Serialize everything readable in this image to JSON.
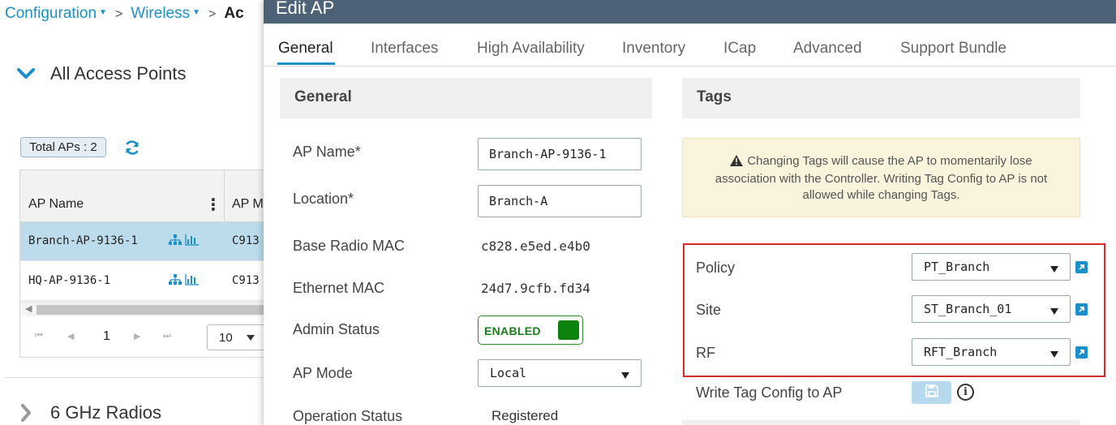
{
  "breadcrumb": {
    "items": [
      "Configuration",
      "Wireless"
    ],
    "separator": ">",
    "current": "Ac"
  },
  "background": {
    "section_all_aps": "All Access Points",
    "total_aps": "Total APs : 2",
    "table": {
      "columns": [
        "AP Name",
        "AP M"
      ],
      "rows": [
        {
          "name": "Branch-AP-9136-1",
          "model": "C913",
          "selected": true
        },
        {
          "name": "HQ-AP-9136-1",
          "model": "C913",
          "selected": false
        }
      ],
      "page": "1",
      "per_page": "10"
    },
    "section_6ghz": "6 GHz Radios"
  },
  "modal": {
    "title": "Edit AP",
    "tabs": [
      {
        "label": "General",
        "active": true
      },
      {
        "label": "Interfaces",
        "active": false
      },
      {
        "label": "High Availability",
        "active": false
      },
      {
        "label": "Inventory",
        "active": false
      },
      {
        "label": "ICap",
        "active": false
      },
      {
        "label": "Advanced",
        "active": false
      },
      {
        "label": "Support Bundle",
        "active": false
      }
    ],
    "general": {
      "heading": "General",
      "ap_name_label": "AP Name*",
      "ap_name_value": "Branch-AP-9136-1",
      "location_label": "Location*",
      "location_value": "Branch-A",
      "base_radio_mac_label": "Base Radio MAC",
      "base_radio_mac_value": "c828.e5ed.e4b0",
      "ethernet_mac_label": "Ethernet MAC",
      "ethernet_mac_value": "24d7.9cfb.fd34",
      "admin_status_label": "Admin Status",
      "admin_status_value": "ENABLED",
      "ap_mode_label": "AP Mode",
      "ap_mode_value": "Local",
      "operation_status_label": "Operation Status",
      "operation_status_value": "Registered"
    },
    "tags": {
      "heading": "Tags",
      "warning": "Changing Tags will cause the AP to momentarily lose association with the Controller. Writing Tag Config to AP is not allowed while changing Tags.",
      "policy_label": "Policy",
      "policy_value": "PT_Branch",
      "site_label": "Site",
      "site_value": "ST_Branch_01",
      "rf_label": "RF",
      "rf_value": "RFT_Branch",
      "write_tag_label": "Write Tag Config to AP"
    }
  },
  "colors": {
    "accent": "#1a8fc8",
    "header": "#4d6177",
    "enabled": "#0d820d",
    "highlight_box": "#d42b2b",
    "warning_bg": "#fbf4dc",
    "selected_row": "#bcdcec"
  },
  "icons": [
    "chevron-down-icon",
    "chevron-right-icon",
    "refresh-icon",
    "kebab-icon",
    "topology-icon",
    "bar-chart-icon",
    "warning-icon",
    "external-link-icon",
    "save-icon",
    "info-icon"
  ]
}
